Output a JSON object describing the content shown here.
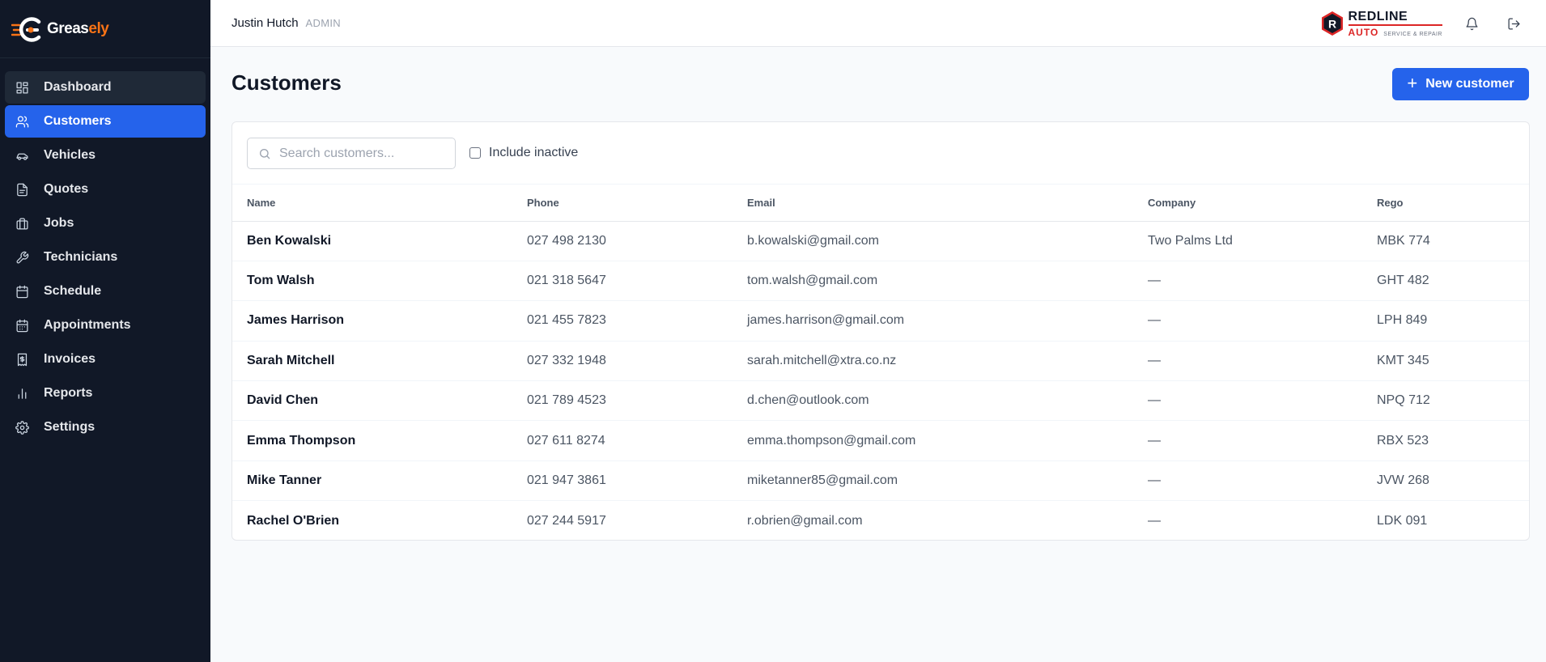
{
  "brand": {
    "name_main": "Greas",
    "name_accent": "ely"
  },
  "sidebar": {
    "items": [
      {
        "id": "dashboard",
        "label": "Dashboard",
        "icon": "layout-grid-icon",
        "state": "hover"
      },
      {
        "id": "customers",
        "label": "Customers",
        "icon": "users-icon",
        "state": "active"
      },
      {
        "id": "vehicles",
        "label": "Vehicles",
        "icon": "car-icon",
        "state": ""
      },
      {
        "id": "quotes",
        "label": "Quotes",
        "icon": "document-icon",
        "state": ""
      },
      {
        "id": "jobs",
        "label": "Jobs",
        "icon": "briefcase-icon",
        "state": ""
      },
      {
        "id": "technicians",
        "label": "Technicians",
        "icon": "wrench-icon",
        "state": ""
      },
      {
        "id": "schedule",
        "label": "Schedule",
        "icon": "calendar-icon",
        "state": ""
      },
      {
        "id": "appointments",
        "label": "Appointments",
        "icon": "calendar-days-icon",
        "state": ""
      },
      {
        "id": "invoices",
        "label": "Invoices",
        "icon": "receipt-icon",
        "state": ""
      },
      {
        "id": "reports",
        "label": "Reports",
        "icon": "bar-chart-icon",
        "state": ""
      },
      {
        "id": "settings",
        "label": "Settings",
        "icon": "gear-icon",
        "state": ""
      }
    ]
  },
  "topbar": {
    "user_name": "Justin Hutch",
    "user_role": "ADMIN",
    "shop_logo": {
      "letter": "R",
      "top": "REDLINE",
      "auto": "AUTO",
      "tagline": "SERVICE & REPAIR"
    }
  },
  "page": {
    "title": "Customers",
    "new_button_label": "New customer"
  },
  "filters": {
    "search_placeholder": "Search customers...",
    "include_inactive_label": "Include inactive"
  },
  "table": {
    "columns": [
      "Name",
      "Phone",
      "Email",
      "Company",
      "Rego"
    ],
    "rows": [
      [
        "Ben Kowalski",
        "027 498 2130",
        "b.kowalski@gmail.com",
        "Two Palms Ltd",
        "MBK 774"
      ],
      [
        "Tom Walsh",
        "021 318 5647",
        "tom.walsh@gmail.com",
        "—",
        "GHT 482"
      ],
      [
        "James Harrison",
        "021 455 7823",
        "james.harrison@gmail.com",
        "—",
        "LPH 849"
      ],
      [
        "Sarah Mitchell",
        "027 332 1948",
        "sarah.mitchell@xtra.co.nz",
        "—",
        "KMT 345"
      ],
      [
        "David Chen",
        "021 789 4523",
        "d.chen@outlook.com",
        "—",
        "NPQ 712"
      ],
      [
        "Emma Thompson",
        "027 611 8274",
        "emma.thompson@gmail.com",
        "—",
        "RBX 523"
      ],
      [
        "Mike Tanner",
        "021 947 3861",
        "miketanner85@gmail.com",
        "—",
        "JVW 268"
      ],
      [
        "Rachel O'Brien",
        "027 244 5917",
        "r.obrien@gmail.com",
        "—",
        "LDK 091"
      ]
    ]
  },
  "colors": {
    "sidebar_bg": "#111827",
    "accent": "#2563eb",
    "brand_orange": "#f97316",
    "logo_red": "#dc2626"
  }
}
